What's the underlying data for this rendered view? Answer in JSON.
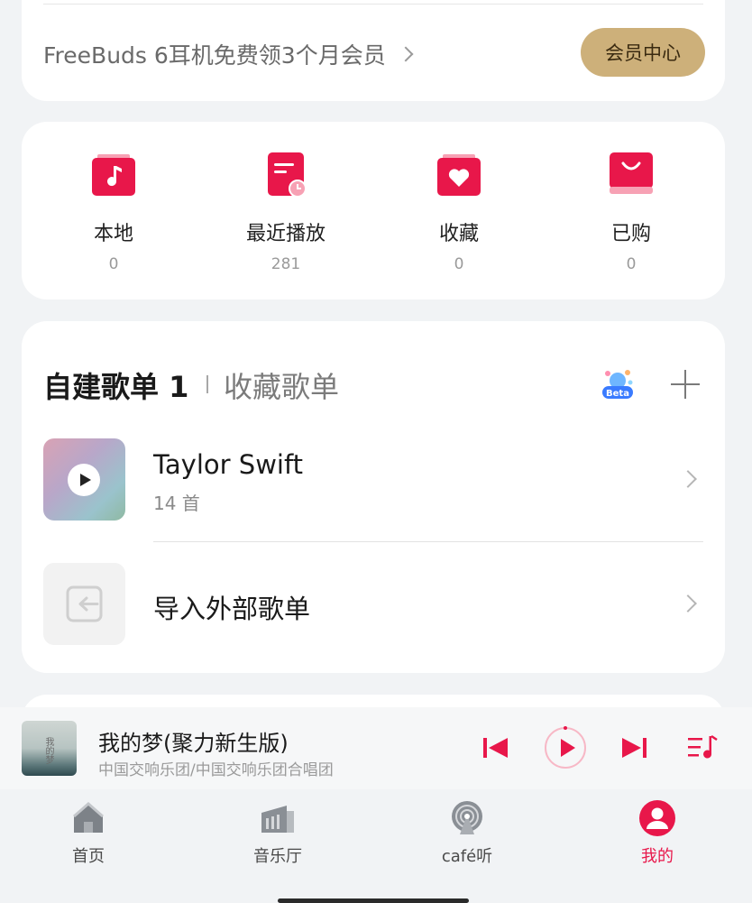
{
  "vip": {
    "promo_text": "FreeBuds 6耳机免费领3个月会员",
    "button_label": "会员中心"
  },
  "quick_entries": [
    {
      "label": "本地",
      "count": "0",
      "icon": "music-note-icon"
    },
    {
      "label": "最近播放",
      "count": "281",
      "icon": "recent-play-icon"
    },
    {
      "label": "收藏",
      "count": "0",
      "icon": "heart-icon"
    },
    {
      "label": "已购",
      "count": "0",
      "icon": "shopping-bag-icon"
    }
  ],
  "playlists": {
    "tab_self": "自建歌单 1",
    "tab_fav": "收藏歌单",
    "beta_badge": "Beta",
    "items": [
      {
        "title": "Taylor Swift",
        "subtitle": "14 首"
      },
      {
        "title": "导入外部歌单"
      }
    ]
  },
  "now_playing": {
    "title": "我的梦(聚力新生版)",
    "artist": "中国交响乐团/中国交响乐团合唱团",
    "cover_text": "我的梦"
  },
  "nav": [
    {
      "label": "首页",
      "icon": "home-icon",
      "active": false
    },
    {
      "label": "音乐厅",
      "icon": "concert-hall-icon",
      "active": false
    },
    {
      "label": "café听",
      "icon": "podcast-icon",
      "active": false
    },
    {
      "label": "我的",
      "icon": "profile-icon",
      "active": true
    }
  ],
  "colors": {
    "accent": "#e8174a",
    "vip_gold": "#cdb07a",
    "background": "#f1f3f5"
  }
}
